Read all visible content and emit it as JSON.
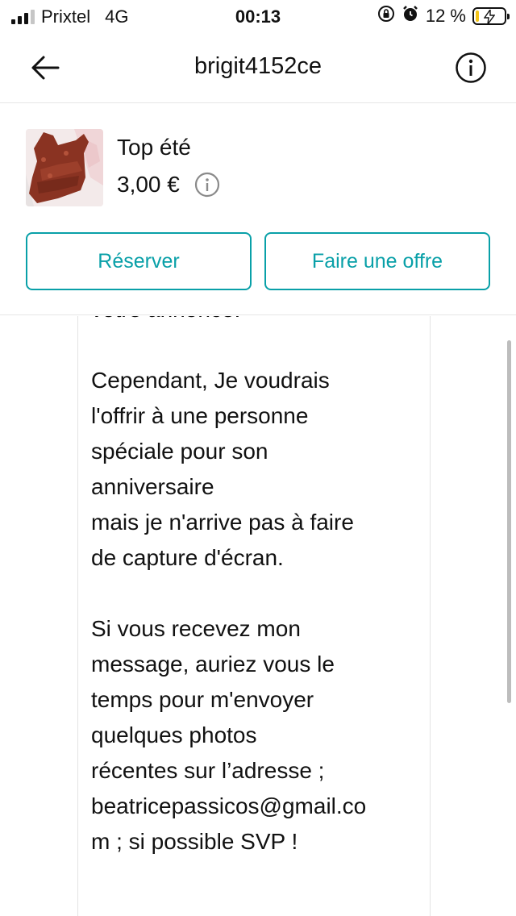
{
  "status_bar": {
    "carrier": "Prixtel",
    "network": "4G",
    "time": "00:13",
    "battery_percent": "12 %",
    "battery_level": 0.12,
    "icons": [
      "signal-icon",
      "orientation-lock-icon",
      "alarm-icon",
      "battery-charging-icon"
    ]
  },
  "header": {
    "title": "brigit4152ce",
    "back_icon": "arrow-left-icon",
    "info_icon": "info-circle-icon"
  },
  "item": {
    "title": "Top été",
    "price": "3,00 €",
    "price_info_icon": "info-circle-icon",
    "thumbnail": "item-photo"
  },
  "actions": {
    "reserve_label": "Réserver",
    "offer_label": "Faire une offre"
  },
  "colors": {
    "accent": "#09a0a8",
    "text": "#111111",
    "divider": "#e6e6e6",
    "battery_fill": "#f5c518"
  },
  "message": {
    "text": "votre annonce.\n\nCependant, Je voudrais\nl'offrir à une personne\nspéciale pour son\nanniversaire\nmais je n'arrive pas à faire\nde capture d'écran.\n\nSi vous recevez mon\nmessage, auriez vous le\ntemps pour m'envoyer\nquelques photos\nrécentes sur l’adresse ;\nbeatricepassicos@gmail.co\nm ; si possible SVP !"
  }
}
